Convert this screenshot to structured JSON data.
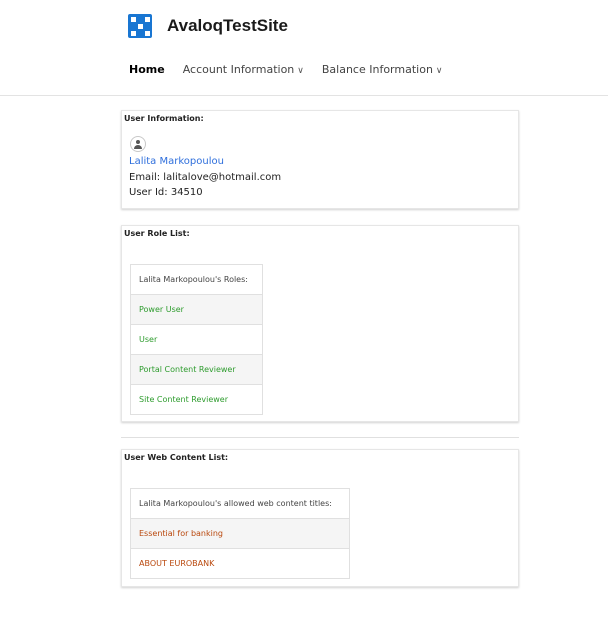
{
  "header": {
    "site_title": "AvaloqTestSite",
    "logo_icon": "grid-logo-icon",
    "nav": [
      {
        "label": "Home",
        "dropdown": false,
        "active": true
      },
      {
        "label": "Account Information",
        "dropdown": true,
        "active": false
      },
      {
        "label": "Balance Information",
        "dropdown": true,
        "active": false
      }
    ]
  },
  "user_info": {
    "title": "User Information:",
    "name": "Lalita Markopoulou",
    "email": "Email: lalitalove@hotmail.com",
    "user_id": "User Id: 34510"
  },
  "role_list": {
    "title": "User Role List:",
    "table_header": "Lalita Markopoulou's Roles:",
    "roles": [
      "Power User",
      "User",
      "Portal Content Reviewer",
      "Site Content Reviewer"
    ]
  },
  "web_content_list": {
    "title": "User Web Content List:",
    "table_header": "Lalita Markopoulou's allowed web content titles:",
    "items": [
      "Essential for banking",
      "ABOUT EUROBANK"
    ]
  },
  "colors": {
    "brand": "#1976d2",
    "link": "#2f6fdc",
    "role_text": "#2e9c2e",
    "web_content_text": "#b9480d"
  }
}
